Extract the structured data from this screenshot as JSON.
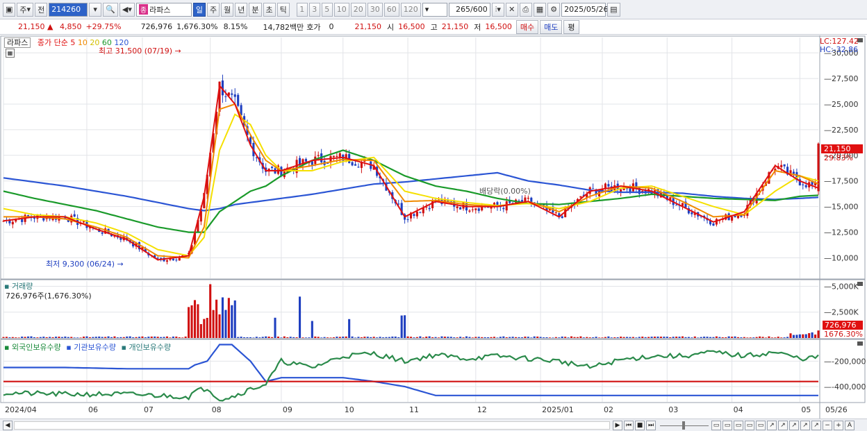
{
  "toolbar": {
    "period_left": "주",
    "prev_label": "전",
    "code": "214260",
    "name_tag": "종",
    "name": "라파스",
    "periods": [
      "일",
      "주",
      "월",
      "년",
      "분",
      "초",
      "틱"
    ],
    "active_period": "일",
    "intervals": [
      "1",
      "3",
      "5",
      "10",
      "20",
      "30",
      "60",
      "120"
    ],
    "count": "265/600",
    "date": "2025/05/26"
  },
  "quote": {
    "price": "21,150",
    "change": "4,850",
    "change_pct": "+29.75%",
    "volume": "726,976",
    "volume_pct": "1,676.30%",
    "turnover_pct": "8.15%",
    "amount": "14,782백만",
    "hoga_label": "호가",
    "hoga_value": "0",
    "hoga_price": "21,150",
    "open_label": "시",
    "open": "16,500",
    "high_label": "고",
    "high": "21,150",
    "low_label": "저",
    "low": "16,500",
    "buy_label": "매수",
    "sell_label": "매도",
    "avg_label": "평"
  },
  "price_panel": {
    "name": "라파스",
    "ma_label": "종가 단순",
    "ma_periods": [
      "5",
      "10",
      "20",
      "60",
      "120"
    ],
    "lc": "LC:127.42",
    "hc": "HC:-32.86",
    "high_note": "최고 31,500 (07/19)",
    "low_note": "최저 9,300 (06/24)",
    "dividend_note": "배당락(0.00%)",
    "current_price": "21,150",
    "current_pct": "29.83%"
  },
  "volume_panel": {
    "title": "거래량",
    "value": "726,976주(1,676.30%)",
    "current": "726,976",
    "current_pct": "1676.30%"
  },
  "holding_panel": {
    "series_names": [
      "외국인보유수량",
      "기관보유수량",
      "개인보유수량"
    ]
  },
  "colors": {
    "ma5": "#e01010",
    "ma10": "#f08a00",
    "ma20": "#f5e000",
    "ma60": "#1a9a2a",
    "ma120": "#2b55d4",
    "up": "#d01010",
    "down": "#1f3fc0"
  },
  "chart_data": [
    {
      "type": "line",
      "panel": "price",
      "y_ticks": [
        "30,000",
        "27,500",
        "25,000",
        "22,500",
        "20,000",
        "17,500",
        "15,000",
        "12,500",
        "10,000"
      ],
      "ylim": [
        8000,
        31500
      ],
      "x_ticks": [
        "2024/04",
        "06",
        "07",
        "08",
        "09",
        "10",
        "11",
        "12",
        "2025/01",
        "02",
        "03",
        "04",
        "05",
        "05/26"
      ],
      "x": [
        0,
        10,
        20,
        30,
        40,
        50,
        60,
        65,
        70,
        75,
        80,
        85,
        90,
        100,
        110,
        120,
        130,
        140,
        150,
        160,
        170,
        180,
        190,
        200,
        210,
        220,
        230,
        240,
        250,
        258,
        264
      ],
      "series": [
        {
          "name": "5",
          "values": [
            13600,
            14000,
            14000,
            12800,
            11800,
            9800,
            10200,
            16000,
            26800,
            25000,
            21000,
            18500,
            18500,
            19500,
            19800,
            19000,
            14000,
            15500,
            15000,
            15000,
            15500,
            14000,
            16500,
            17000,
            16500,
            15000,
            13500,
            14500,
            19000,
            17500,
            16800
          ]
        },
        {
          "name": "10",
          "values": [
            14000,
            14000,
            13800,
            13000,
            12000,
            10200,
            10000,
            13000,
            24500,
            25000,
            22000,
            19500,
            18500,
            19000,
            19600,
            19500,
            15500,
            15600,
            15200,
            15000,
            15500,
            14500,
            16000,
            17000,
            16800,
            15500,
            14000,
            14200,
            18500,
            18000,
            17200
          ]
        },
        {
          "name": "20",
          "values": [
            14800,
            14200,
            14000,
            13400,
            12400,
            10800,
            10200,
            12000,
            20500,
            24000,
            23000,
            20000,
            18500,
            18500,
            19400,
            19800,
            16500,
            15800,
            15400,
            15100,
            15300,
            14800,
            15500,
            16800,
            17000,
            16000,
            15000,
            14200,
            16500,
            18000,
            17500
          ]
        },
        {
          "name": "60",
          "values": [
            16500,
            15800,
            15200,
            14600,
            13800,
            13000,
            12500,
            12500,
            14500,
            15500,
            16500,
            17000,
            18000,
            19500,
            20500,
            19500,
            18000,
            17000,
            16500,
            15800,
            15300,
            15200,
            15500,
            15800,
            16200,
            16000,
            15800,
            15700,
            15600,
            16000,
            16100
          ]
        },
        {
          "name": "120",
          "values": [
            17800,
            17400,
            17000,
            16500,
            16000,
            15400,
            14800,
            14600,
            14800,
            15200,
            15400,
            15600,
            15800,
            16200,
            16700,
            17200,
            17400,
            17700,
            18000,
            18300,
            17500,
            17100,
            16600,
            16400,
            16400,
            16300,
            16000,
            15800,
            15700,
            15800,
            15900
          ]
        }
      ]
    },
    {
      "type": "bar",
      "panel": "volume",
      "y_ticks": [
        "5,000K",
        "2,500K"
      ],
      "ylim": [
        0,
        5500000
      ]
    },
    {
      "type": "line",
      "panel": "holdings",
      "y_ticks": [
        "-200,000",
        "-400,000"
      ],
      "x": [
        0,
        20,
        40,
        60,
        62,
        66,
        70,
        74,
        80,
        85,
        90,
        100,
        110,
        120,
        130,
        140,
        150,
        160,
        170,
        180,
        190,
        200,
        210,
        220,
        230,
        240,
        250,
        258,
        264
      ],
      "series": [
        {
          "name": "외국인보유수량",
          "values": [
            -250000,
            -250000,
            -260000,
            -260000,
            -230000,
            -200000,
            -70000,
            -70000,
            -200000,
            -360000,
            -330000,
            -330000,
            -330000,
            -360000,
            -400000,
            -470000,
            -470000,
            -470000,
            -470000,
            -470000,
            -470000,
            -470000,
            -470000,
            -470000,
            -470000,
            -470000,
            -470000,
            -470000,
            -470000
          ]
        },
        {
          "name": "기관보유수량",
          "values": [
            -360000,
            -360000,
            -360000,
            -360000,
            -360000,
            -360000,
            -360000,
            -360000,
            -360000,
            -360000,
            -360000,
            -360000,
            -360000,
            -360000,
            -360000,
            -360000,
            -360000,
            -360000,
            -360000,
            -360000,
            -360000,
            -360000,
            -360000,
            -360000,
            -360000,
            -360000,
            -360000,
            -360000,
            -360000
          ]
        },
        {
          "name": "개인보유수량",
          "values": [
            -450000,
            -460000,
            -460000,
            -480000,
            -440000,
            -410000,
            -500000,
            -480000,
            -420000,
            -380000,
            -200000,
            -250000,
            -160000,
            -140000,
            -200000,
            -150000,
            -180000,
            -160000,
            -180000,
            -200000,
            -250000,
            -190000,
            -160000,
            -160000,
            -130000,
            -160000,
            -130000,
            -180000,
            -170000
          ]
        }
      ]
    }
  ]
}
